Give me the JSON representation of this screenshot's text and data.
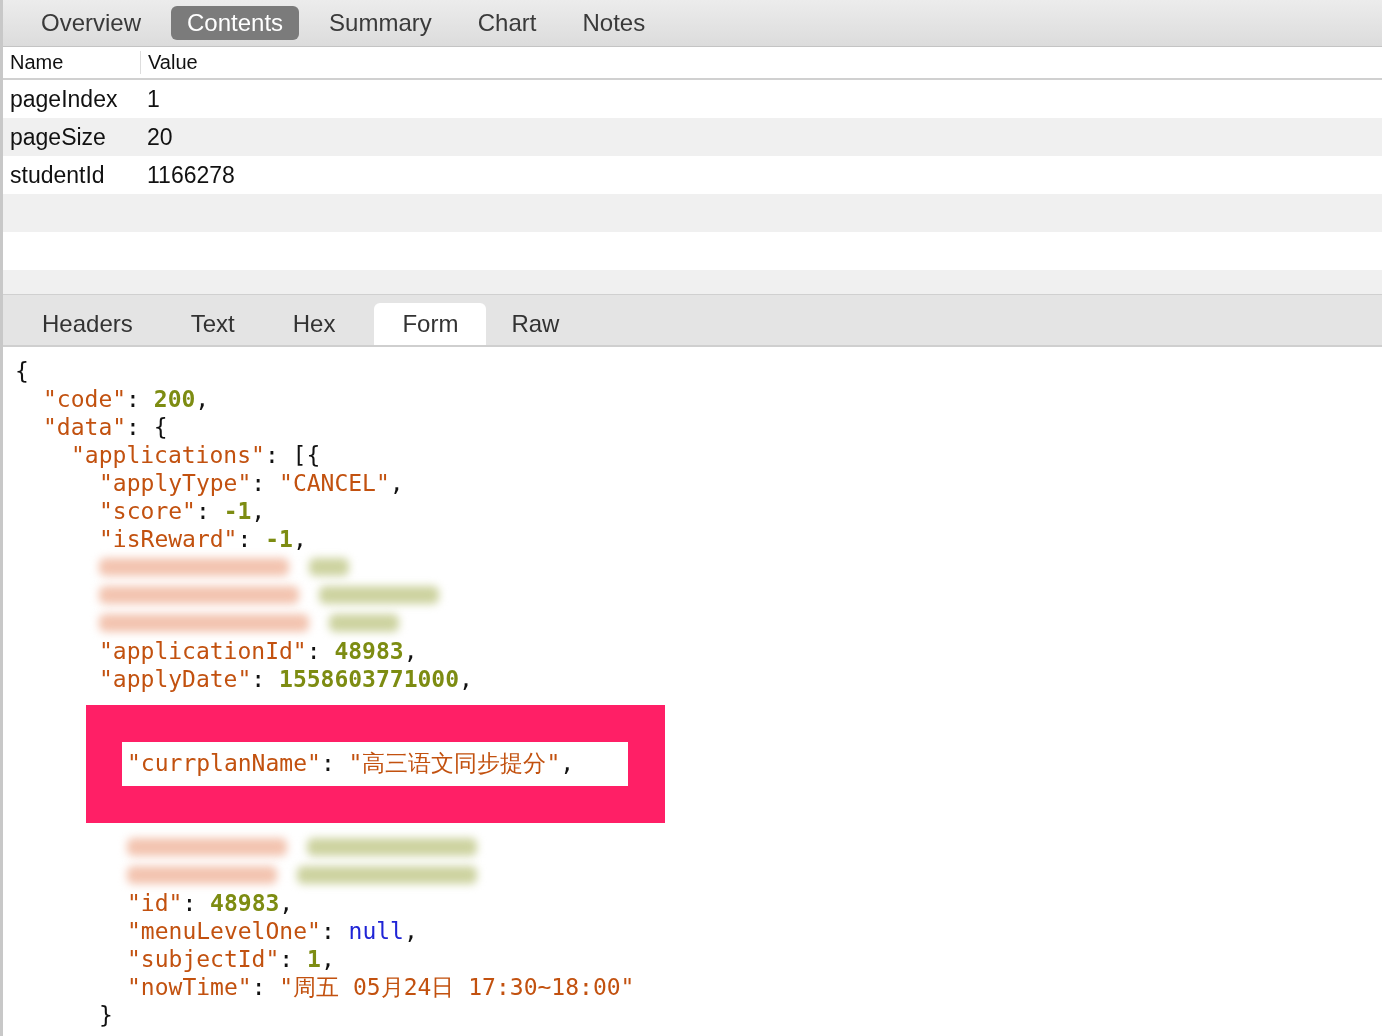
{
  "top_tabs": [
    {
      "label": "Overview",
      "selected": false
    },
    {
      "label": "Contents",
      "selected": true
    },
    {
      "label": "Summary",
      "selected": false
    },
    {
      "label": "Chart",
      "selected": false
    },
    {
      "label": "Notes",
      "selected": false
    }
  ],
  "table": {
    "columns": [
      "Name",
      "Value"
    ],
    "rows": [
      {
        "name": "pageIndex",
        "value": "1"
      },
      {
        "name": "pageSize",
        "value": "20"
      },
      {
        "name": "studentId",
        "value": "1166278"
      }
    ]
  },
  "body_tabs": [
    {
      "label": "Headers",
      "selected": false
    },
    {
      "label": "Text",
      "selected": false
    },
    {
      "label": "Hex",
      "selected": false
    },
    {
      "label": "Form",
      "selected": true
    },
    {
      "label": "Raw",
      "selected": false
    }
  ],
  "json_view": {
    "kind": "open",
    "bracket": "{",
    "children": [
      {
        "kind": "number_pair",
        "key": "\"code\"",
        "sep": ": ",
        "value": "200",
        "tail": ","
      },
      {
        "kind": "open",
        "key": "\"data\"",
        "sep": ": ",
        "bracket": "{",
        "children": [
          {
            "kind": "open",
            "key": "\"applications\"",
            "sep": ": ",
            "bracket": "[{",
            "children": [
              {
                "kind": "string_pair",
                "key": "\"applyType\"",
                "sep": ": ",
                "value": "\"CANCEL\"",
                "tail": ","
              },
              {
                "kind": "number_pair",
                "key": "\"score\"",
                "sep": ": ",
                "value": "-1",
                "tail": ","
              },
              {
                "kind": "number_pair",
                "key": "\"isReward\"",
                "sep": ": ",
                "value": "-1",
                "tail": ","
              },
              {
                "kind": "blurred"
              },
              {
                "kind": "blurred"
              },
              {
                "kind": "blurred"
              },
              {
                "kind": "number_pair",
                "key": "\"applicationId\"",
                "sep": ": ",
                "value": "48983",
                "tail": ","
              },
              {
                "kind": "number_pair",
                "key": "\"applyDate\"",
                "sep": ": ",
                "value": "1558603771000",
                "tail": ","
              },
              {
                "kind": "covered_open",
                "close": "}",
                "children": [
                  {
                    "kind": "hidden"
                  },
                  {
                    "kind": "string_pair",
                    "key": "\"currplanName\"",
                    "sep": ": ",
                    "value": "\"高三语文同步提分\"",
                    "tail": ","
                  },
                  {
                    "kind": "hidden"
                  },
                  {
                    "kind": "hidden"
                  },
                  {
                    "kind": "blurred"
                  },
                  {
                    "kind": "blurred"
                  },
                  {
                    "kind": "number_pair",
                    "key": "\"id\"",
                    "sep": ": ",
                    "value": "48983",
                    "tail": ","
                  },
                  {
                    "kind": "null_pair",
                    "key": "\"menuLevelOne\"",
                    "sep": ": ",
                    "value": "null",
                    "tail": ","
                  },
                  {
                    "kind": "number_pair",
                    "key": "\"subjectId\"",
                    "sep": ": ",
                    "value": "1",
                    "tail": ","
                  },
                  {
                    "kind": "string_pair",
                    "key": "\"nowTime\"",
                    "sep": ": ",
                    "value": "\"周五 05月24日 17:30~18:00\""
                  }
                ]
              }
            ]
          }
        ]
      }
    ]
  }
}
